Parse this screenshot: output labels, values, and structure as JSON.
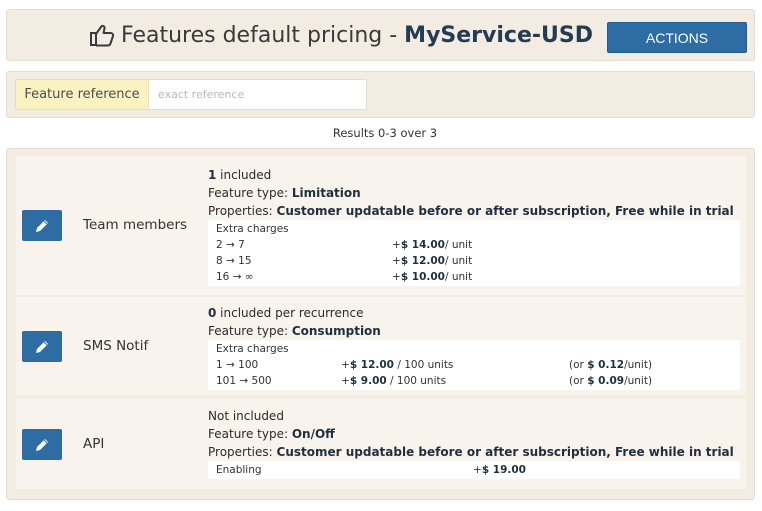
{
  "header": {
    "title_prefix": "Features default pricing - ",
    "service_name": "MyService-USD",
    "actions_label": "ACTIONS"
  },
  "search": {
    "label": "Feature reference",
    "placeholder": "exact reference"
  },
  "results_text": "Results 0-3 over 3",
  "features": [
    {
      "name": "Team members",
      "included_value": "1",
      "included_text": " included",
      "type_label": "Feature type: ",
      "type_value": "Limitation",
      "properties_label": "Properties: ",
      "properties_value": "Customer updatable before or after subscription, Free while in trial",
      "charges_title": "Extra charges",
      "charges": [
        {
          "range": "2 → 7",
          "prefix": "+",
          "price": "$ 14.00",
          "unit": " / unit"
        },
        {
          "range": "8 → 15",
          "prefix": "+",
          "price": "$ 12.00",
          "unit": " / unit"
        },
        {
          "range": "16 → ∞",
          "prefix": "+",
          "price": "$ 10.00",
          "unit": " / unit"
        }
      ]
    },
    {
      "name": "SMS Notif",
      "included_value": "0",
      "included_text": " included per recurrence",
      "type_label": "Feature type: ",
      "type_value": "Consumption",
      "charges_title": "Extra charges",
      "charges": [
        {
          "range": "1 → 100",
          "prefix": "+",
          "price": "$ 12.00",
          "unit": " / 100 units",
          "per_prefix": "(or ",
          "per_price": "$ 0.12",
          "per_suffix": "/unit)"
        },
        {
          "range": "101 → 500",
          "prefix": "+",
          "price": "$ 9.00",
          "unit": " / 100 units",
          "per_prefix": "(or ",
          "per_price": "$ 0.09",
          "per_suffix": "/unit)"
        }
      ]
    },
    {
      "name": "API",
      "included_text": "Not included",
      "type_label": "Feature type: ",
      "type_value": "On/Off",
      "properties_label": "Properties: ",
      "properties_value": "Customer updatable before or after subscription, Free while in trial",
      "enabling_label": "Enabling",
      "enabling_prefix": "+",
      "enabling_price": "$ 19.00"
    }
  ],
  "icons": {
    "title_icon": "thumbs-up-icon",
    "edit_icon": "pencil-icon"
  },
  "colors": {
    "primary": "#2e6da4",
    "panel_bg": "#f3ece2",
    "label_bg": "#fbf2c1"
  }
}
